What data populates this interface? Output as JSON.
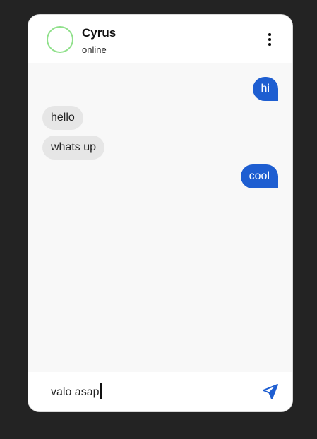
{
  "contact": {
    "name": "Cyrus",
    "status": "online"
  },
  "messages": [
    {
      "text": "hi",
      "from": "me"
    },
    {
      "text": "hello",
      "from": "them"
    },
    {
      "text": "whats up",
      "from": "them"
    },
    {
      "text": "cool",
      "from": "me"
    }
  ],
  "composer": {
    "value": "valo asap"
  },
  "icons": {
    "menu": "more-vertical-icon",
    "send": "send-icon"
  },
  "colors": {
    "background": "#232323",
    "sent_bubble": "#1e5ed1",
    "received_bubble": "#e6e6e6",
    "avatar_ring": "#8fe08a"
  }
}
